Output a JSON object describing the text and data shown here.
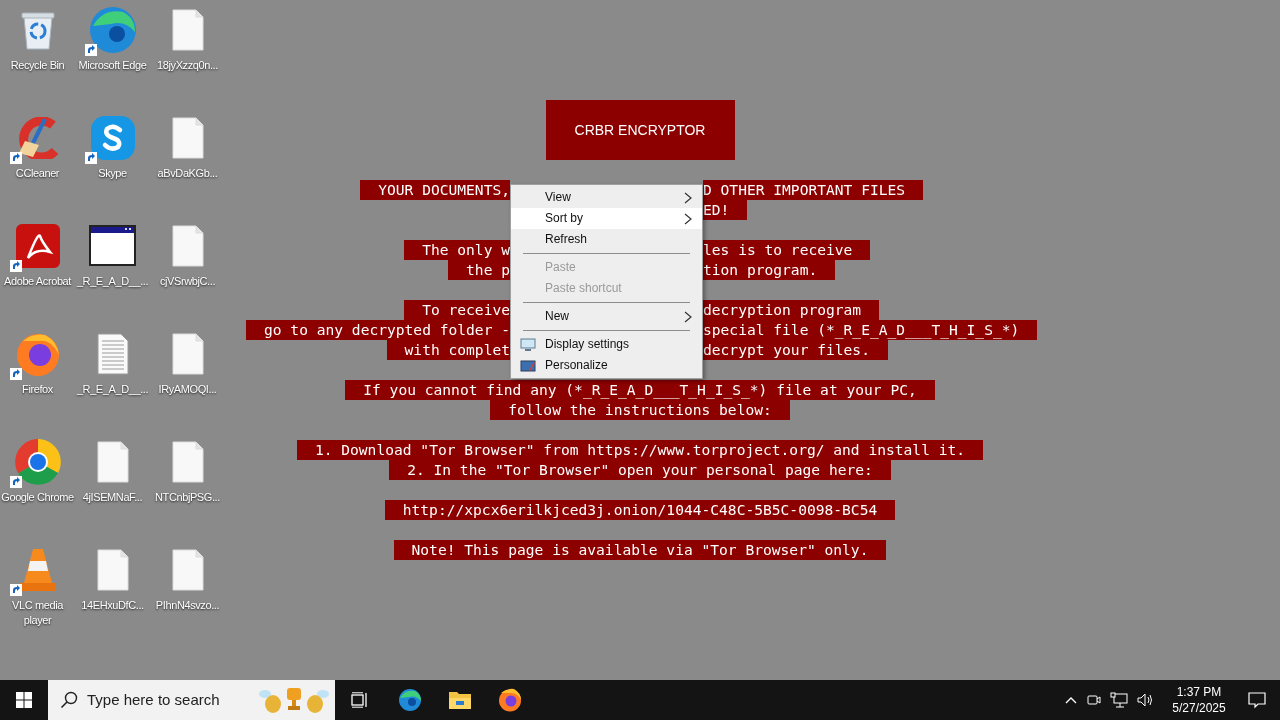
{
  "desktop_icons": [
    {
      "label": "Recycle Bin",
      "kind": "recycle-bin",
      "shortcut": false
    },
    {
      "label": "CCleaner",
      "kind": "cleaner",
      "shortcut": true
    },
    {
      "label": "Adobe Acrobat",
      "kind": "pdf",
      "shortcut": true
    },
    {
      "label": "Firefox",
      "kind": "firefox",
      "shortcut": true
    },
    {
      "label": "Google Chrome",
      "kind": "chrome",
      "shortcut": true
    },
    {
      "label": "VLC media player",
      "kind": "cone",
      "shortcut": true
    },
    {
      "label": "Microsoft Edge",
      "kind": "edge",
      "shortcut": true
    },
    {
      "label": "Skype",
      "kind": "chat",
      "shortcut": true
    },
    {
      "label": "_R_E_A_D__...",
      "kind": "window",
      "shortcut": false
    },
    {
      "label": "_R_E_A_D__...",
      "kind": "text-document",
      "shortcut": false
    },
    {
      "label": "4jISEMNaF...",
      "kind": "document",
      "shortcut": false
    },
    {
      "label": "14EHxuDfC...",
      "kind": "document",
      "shortcut": false
    },
    {
      "label": "18jyXzzq0n...",
      "kind": "document",
      "shortcut": false
    },
    {
      "label": "aBvDaKGb...",
      "kind": "document",
      "shortcut": false
    },
    {
      "label": "cjVSrwbjC...",
      "kind": "document",
      "shortcut": false
    },
    {
      "label": "IRyAMOQI...",
      "kind": "document",
      "shortcut": false
    },
    {
      "label": "NTCnbjPSG...",
      "kind": "document",
      "shortcut": false
    },
    {
      "label": "PIhnN4svzo...",
      "kind": "document",
      "shortcut": false
    }
  ],
  "wallpaper": {
    "title": "CRBR ENCRYPTOR",
    "paragraphs": [
      [
        {
          "kind": "split",
          "left": "YOUR DOCUMENTS,",
          "right": "D OTHER IMPORTANT FILES"
        },
        {
          "kind": "split",
          "right": "ED!"
        }
      ],
      [
        {
          "kind": "split",
          "left": "The only w",
          "right": "les is to receive"
        },
        {
          "kind": "split",
          "left": "the p",
          "right": "tion program."
        }
      ],
      [
        {
          "kind": "split",
          "left": "To receive",
          "right": "decryption program"
        },
        {
          "kind": "split",
          "left": "go to any decrypted folder -",
          "right": "special file (*_R_E_A_D___T_H_I_S_*)"
        },
        {
          "kind": "split",
          "left": "with complet",
          "right": "decrypt your files."
        }
      ],
      [
        {
          "kind": "full",
          "text": "If you cannot find any (*_R_E_A_D___T_H_I_S_*) file at your PC,"
        },
        {
          "kind": "full",
          "text": "follow the instructions below:"
        }
      ],
      [
        {
          "kind": "full",
          "text": "1. Download \"Tor Browser\" from https://www.torproject.org/ and install it."
        },
        {
          "kind": "full",
          "text": "2. In the \"Tor Browser\" open your personal page here:"
        }
      ],
      [
        {
          "kind": "full",
          "text": "http://xpcx6erilkjced3j.onion/1044-C48C-5B5C-0098-BC54"
        }
      ],
      [
        {
          "kind": "full",
          "text": "Note! This page is available via \"Tor Browser\" only."
        }
      ]
    ]
  },
  "context_menu": [
    {
      "kind": "submenu",
      "label": "View",
      "selected": false,
      "disabled": false
    },
    {
      "kind": "submenu",
      "label": "Sort by",
      "selected": true,
      "disabled": false
    },
    {
      "kind": "command",
      "label": "Refresh",
      "selected": false,
      "disabled": false
    },
    {
      "kind": "separator"
    },
    {
      "kind": "command",
      "label": "Paste",
      "selected": false,
      "disabled": true
    },
    {
      "kind": "command",
      "label": "Paste shortcut",
      "selected": false,
      "disabled": true
    },
    {
      "kind": "separator"
    },
    {
      "kind": "submenu",
      "label": "New",
      "selected": false,
      "disabled": false
    },
    {
      "kind": "separator"
    },
    {
      "kind": "display",
      "label": "Display settings",
      "selected": false,
      "disabled": false
    },
    {
      "kind": "personalize",
      "label": "Personalize",
      "selected": false,
      "disabled": false
    }
  ],
  "taskbar": {
    "search": {
      "placeholder": "Type here to search"
    },
    "time": "1:37 PM",
    "date": "5/27/2025"
  }
}
